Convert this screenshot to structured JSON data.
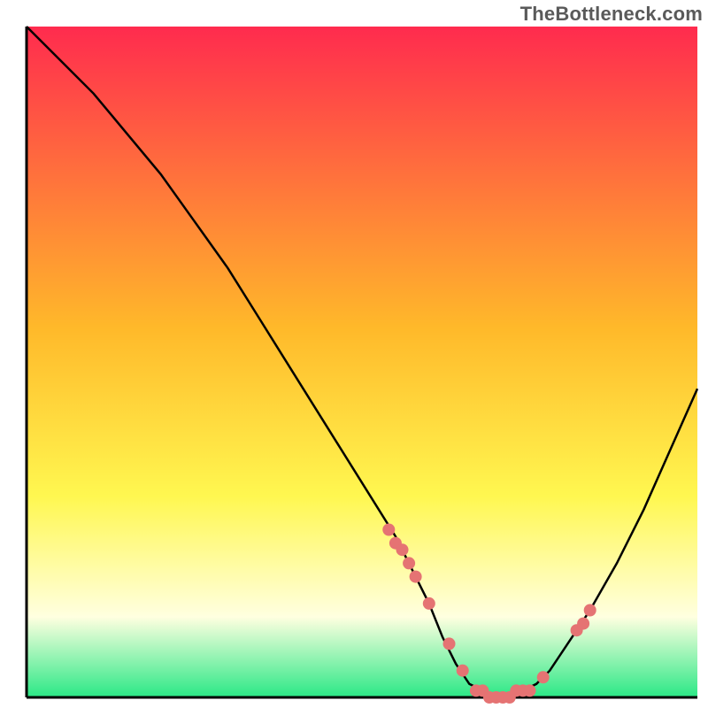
{
  "watermark": "TheBottleneck.com",
  "colors": {
    "gradient_top": "#ff2b4e",
    "gradient_mid1": "#ffb92a",
    "gradient_mid2": "#fff750",
    "gradient_yellow_white": "#ffffe0",
    "gradient_bottom": "#2ae886",
    "axis": "#000000",
    "curve": "#000000",
    "points": "#e57373"
  },
  "chart_data": {
    "type": "line",
    "title": "",
    "xlabel": "",
    "ylabel": "",
    "xlim": [
      0,
      100
    ],
    "ylim": [
      0,
      100
    ],
    "curve": {
      "x": [
        0,
        5,
        10,
        15,
        20,
        25,
        30,
        35,
        40,
        45,
        50,
        55,
        60,
        62,
        64,
        66,
        68,
        70,
        72,
        74,
        76,
        78,
        80,
        84,
        88,
        92,
        96,
        100
      ],
      "y": [
        100,
        95,
        90,
        84,
        78,
        71,
        64,
        56,
        48,
        40,
        32,
        24,
        14,
        9,
        5,
        2,
        1,
        0,
        0,
        1,
        2,
        4,
        7,
        13,
        20,
        28,
        37,
        46
      ]
    },
    "points": {
      "x": [
        54,
        55,
        56,
        57,
        58,
        60,
        63,
        65,
        67,
        68,
        69,
        70,
        71,
        72,
        73,
        74,
        75,
        77,
        82,
        83,
        84
      ],
      "y": [
        25,
        23,
        22,
        20,
        18,
        14,
        8,
        4,
        1,
        1,
        0,
        0,
        0,
        0,
        1,
        1,
        1,
        3,
        10,
        11,
        13
      ]
    }
  }
}
